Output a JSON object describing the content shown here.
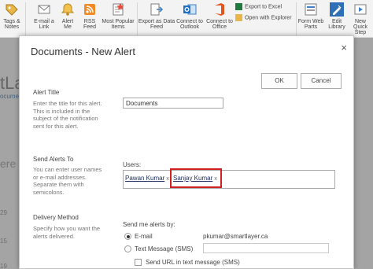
{
  "ribbon": {
    "items": [
      {
        "label": "Tags &\nNotes",
        "icon": "tag-icon"
      },
      {
        "label": "E-mail a\nLink",
        "icon": "email-icon"
      },
      {
        "label": "Alert\nMe",
        "icon": "alert-bell-icon"
      },
      {
        "label": "RSS\nFeed",
        "icon": "rss-icon"
      },
      {
        "label": "Most Popular\nItems",
        "icon": "popular-items-icon"
      },
      {
        "label": "Export as Data\nFeed",
        "icon": "export-feed-icon"
      },
      {
        "label": "Connect to\nOutlook",
        "icon": "outlook-icon"
      },
      {
        "label": "Connect to\nOffice",
        "icon": "office-icon"
      },
      {
        "label": "Form Web\nParts",
        "icon": "form-web-parts-icon"
      },
      {
        "label": "Edit\nLibrary",
        "icon": "edit-library-icon"
      },
      {
        "label": "New Quick\nStep",
        "icon": "quick-step-icon"
      }
    ],
    "export_excel": "Export to Excel",
    "open_explorer": "Open with Explorer"
  },
  "background": {
    "site_fragment": "tLa",
    "doc_link": "ocumen",
    "search_fragment": "ere",
    "num1": "29",
    "num2": "15",
    "num3": "19"
  },
  "dialog": {
    "title": "Documents - New Alert",
    "close": "×",
    "ok": "OK",
    "cancel": "Cancel",
    "alert_title": {
      "heading": "Alert Title",
      "description": "Enter the title for this alert. This is included in the subject of the notification sent for this alert.",
      "value": "Documents"
    },
    "send_alerts_to": {
      "heading": "Send Alerts To",
      "description": "You can enter user names or e-mail addresses. Separate them with semicolons.",
      "users_label": "Users:",
      "users": [
        {
          "name": "Pawan Kumar",
          "remove": "x"
        },
        {
          "name": "Sanjay Kumar",
          "remove": "x"
        }
      ]
    },
    "delivery_method": {
      "heading": "Delivery Method",
      "description": "Specify how you want the alerts delivered.",
      "send_label": "Send me alerts by:",
      "email_option": "E-mail",
      "email_address": "pkumar@smartlayer.ca",
      "sms_option": "Text Message (SMS)",
      "send_url_option": "Send URL in text message (SMS)",
      "selected": "E-mail"
    }
  },
  "colors": {
    "highlight": "#d21f1f",
    "link": "#1a2b5f"
  }
}
